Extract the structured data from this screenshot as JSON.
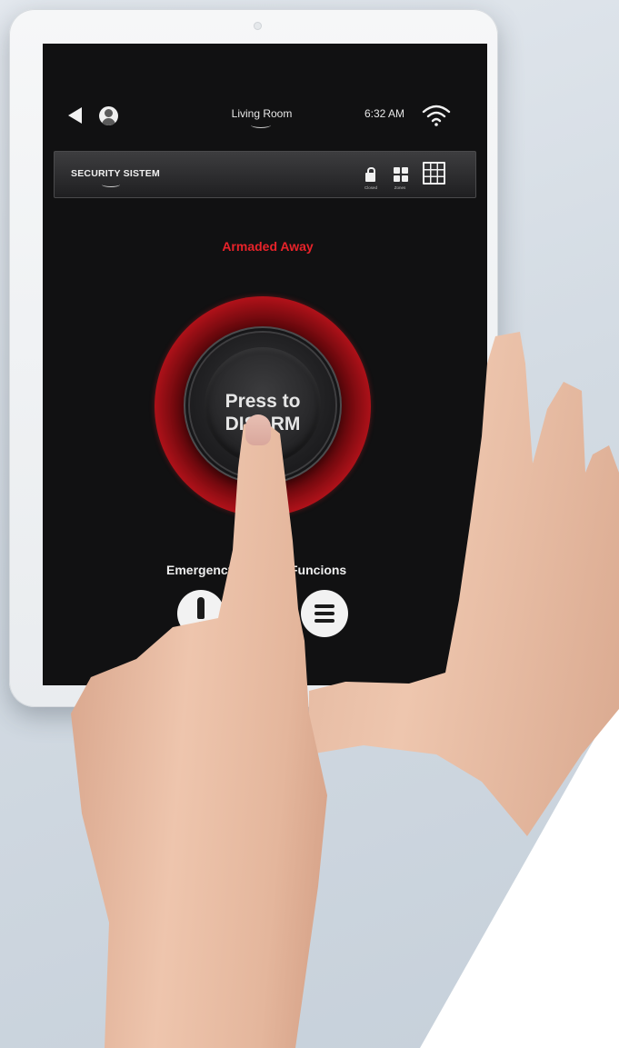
{
  "top_bar": {
    "room": "Living Room",
    "time": "6:32 AM"
  },
  "security_bar": {
    "title": "SECURITY SISTEM",
    "lock_label": "Closed",
    "zones_label": "Zones"
  },
  "status": {
    "text": "Armaded Away",
    "color": "#e8232a"
  },
  "disarm_button": {
    "line1": "Press to",
    "line2": "DISARM"
  },
  "bottom_actions": {
    "emergency_label": "Emergency",
    "functions_label": "Funcions"
  },
  "icons": [
    "back-icon",
    "avatar",
    "wifi-icon",
    "lock-icon",
    "zones-icon",
    "grid-view-icon",
    "emergency-icon",
    "menu-icon"
  ]
}
